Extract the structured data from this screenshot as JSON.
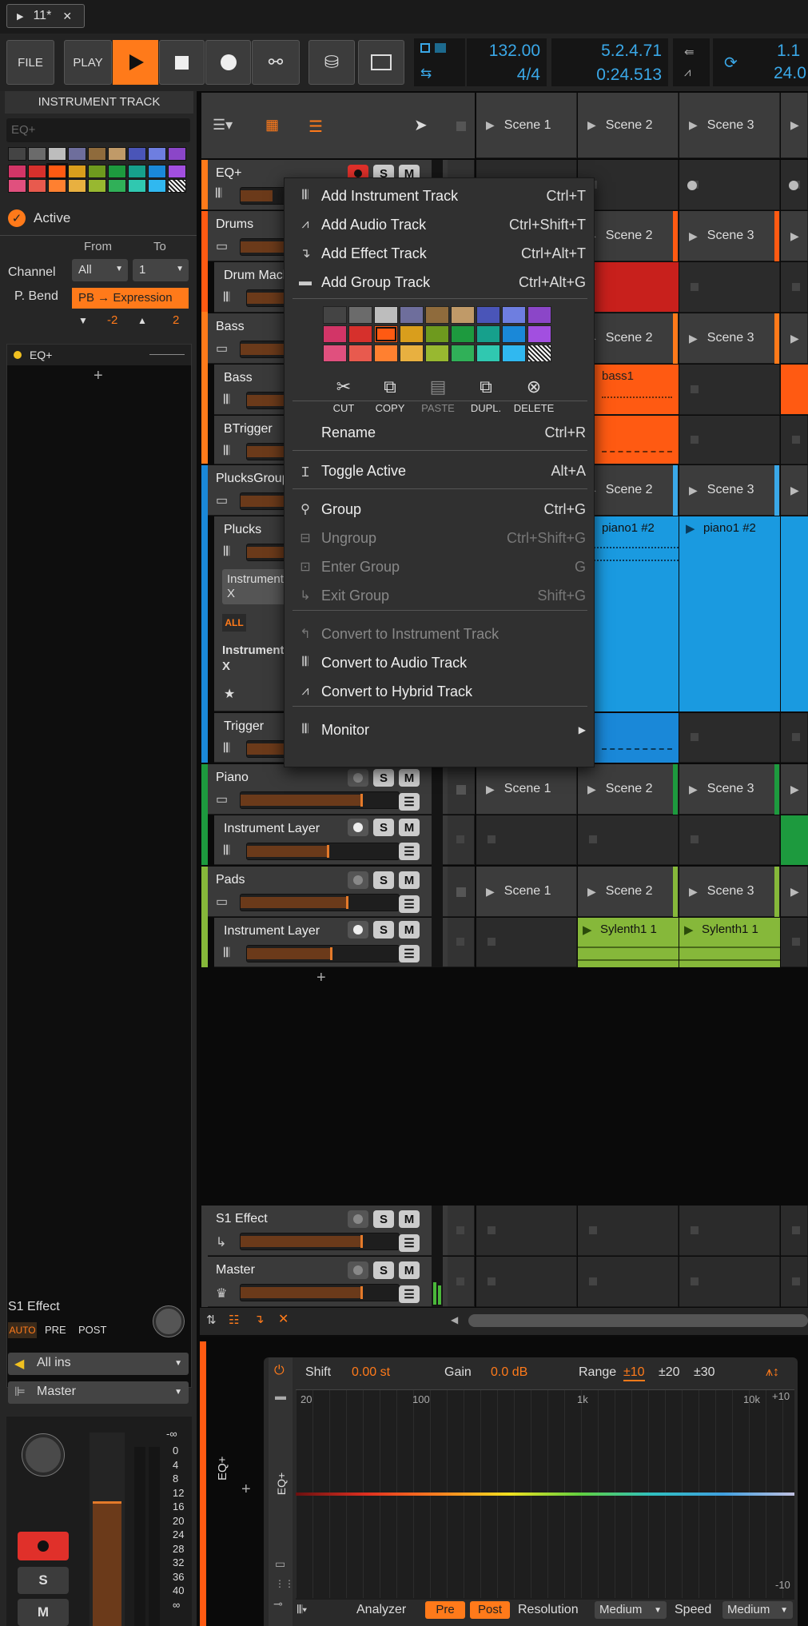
{
  "window": {
    "tab_label": "11*",
    "play_glyph": "▶",
    "close_glyph": "✕"
  },
  "transport": {
    "file": "FILE",
    "play": "PLAY",
    "tempo": "132.00",
    "time_sig": "4/4",
    "position": "5.2.4.71",
    "time": "0:24.513",
    "loop_start": "1.1",
    "loop_end": "24.0"
  },
  "inspector": {
    "title": "INSTRUMENT TRACK",
    "name_placeholder": "EQ+",
    "active_label": "Active",
    "from_label": "From",
    "to_label": "To",
    "channel_label": "Channel",
    "channel_from": "All",
    "channel_to": "1",
    "pbend_label": "P. Bend",
    "pbend_value": "PB → Expression",
    "pb_min": "-2",
    "pb_max": "2",
    "device_name": "EQ+",
    "add": "+"
  },
  "inspector_bottom": {
    "track_name": "S1 Effect",
    "auto": "AUTO",
    "pre": "PRE",
    "post": "POST",
    "input": "All ins",
    "output": "Master",
    "db_top": "-∞",
    "db_scale": [
      "0",
      "4",
      "8",
      "12",
      "16",
      "20",
      "24",
      "28",
      "32",
      "36",
      "40"
    ],
    "db_bottom": "∞",
    "solo": "S",
    "mute": "M"
  },
  "tracks": [
    {
      "name": "EQ+"
    },
    {
      "name": "Drums"
    },
    {
      "name": "Drum Machine"
    },
    {
      "name": "Bass"
    },
    {
      "name": "Bass"
    },
    {
      "name": "BTrigger"
    },
    {
      "name": "PlucksGroup"
    },
    {
      "name": "Plucks"
    },
    {
      "name": "Instrument X"
    },
    {
      "name": "ALL"
    },
    {
      "name": "Instrument Mix X"
    },
    {
      "name": "Trigger"
    },
    {
      "name": "Piano"
    },
    {
      "name": "Instrument Layer"
    },
    {
      "name": "Pads"
    },
    {
      "name": "Instrument Layer"
    },
    {
      "name": "S1 Effect"
    },
    {
      "name": "Master"
    }
  ],
  "solo": "S",
  "mute": "M",
  "add_track": "+",
  "scenes": {
    "header": [
      "Scene 1",
      "Scene 2",
      "Scene 3"
    ],
    "s1": "Scene 1",
    "s2": "Scene 2",
    "s3": "Scene 3"
  },
  "clips": {
    "bass1": "bass1",
    "piano1a": "piano1 #2",
    "piano1b": "piano1 #2",
    "syl1": "Sylenth1 1",
    "syl2": "Sylenth1 1"
  },
  "menu": {
    "items": [
      {
        "label": "Add Instrument Track",
        "key": "Ctrl+T"
      },
      {
        "label": "Add Audio Track",
        "key": "Ctrl+Shift+T"
      },
      {
        "label": "Add Effect Track",
        "key": "Ctrl+Alt+T"
      },
      {
        "label": "Add Group Track",
        "key": "Ctrl+Alt+G"
      },
      {
        "label": "Rename",
        "key": "Ctrl+R"
      },
      {
        "label": "Toggle Active",
        "key": "Alt+A"
      },
      {
        "label": "Group",
        "key": "Ctrl+G"
      },
      {
        "label": "Ungroup",
        "key": "Ctrl+Shift+G"
      },
      {
        "label": "Enter Group",
        "key": "G"
      },
      {
        "label": "Exit Group",
        "key": "Shift+G"
      },
      {
        "label": "Convert to Instrument Track",
        "key": ""
      },
      {
        "label": "Convert to Audio Track",
        "key": ""
      },
      {
        "label": "Convert to Hybrid Track",
        "key": ""
      },
      {
        "label": "Monitor",
        "key": "▶"
      }
    ],
    "tools": [
      "CUT",
      "COPY",
      "PASTE",
      "DUPL.",
      "DELETE"
    ],
    "swatches": [
      "#444444",
      "#6b6b6b",
      "#bdbdbd",
      "#6e6e9c",
      "#8f6b3c",
      "#c09a68",
      "#4a55b8",
      "#6e7ee0",
      "#8b46c8",
      "#d23567",
      "#d6302c",
      "#ff5a12",
      "#d99e1c",
      "#6e9a1e",
      "#1d9a3e",
      "#16a08c",
      "#1a88d8",
      "#a24fe0",
      "#e0507e",
      "#e85a4e",
      "#ff8030",
      "#e8b040",
      "#98b830",
      "#30b058",
      "#30c8b0",
      "#30b8f0",
      "hatch"
    ]
  },
  "eq": {
    "device": "EQ+",
    "shift_label": "Shift",
    "shift_value": "0.00 st",
    "gain_label": "Gain",
    "gain_value": "0.0 dB",
    "range_label": "Range",
    "range_opts": [
      "±10",
      "±20",
      "±30"
    ],
    "freq": [
      "20",
      "100",
      "1k",
      "10k"
    ],
    "db_top": "+10",
    "db_bot": "-10",
    "analyzer": "Analyzer",
    "pre": "Pre",
    "post": "Post",
    "res_label": "Resolution",
    "res_value": "Medium",
    "speed_label": "Speed",
    "speed_value": "Medium"
  },
  "colors": {
    "accent": "#ff7a1a",
    "panel": "#3a3a3a",
    "blue": "#3aa8e8",
    "green": "#86b83a"
  }
}
